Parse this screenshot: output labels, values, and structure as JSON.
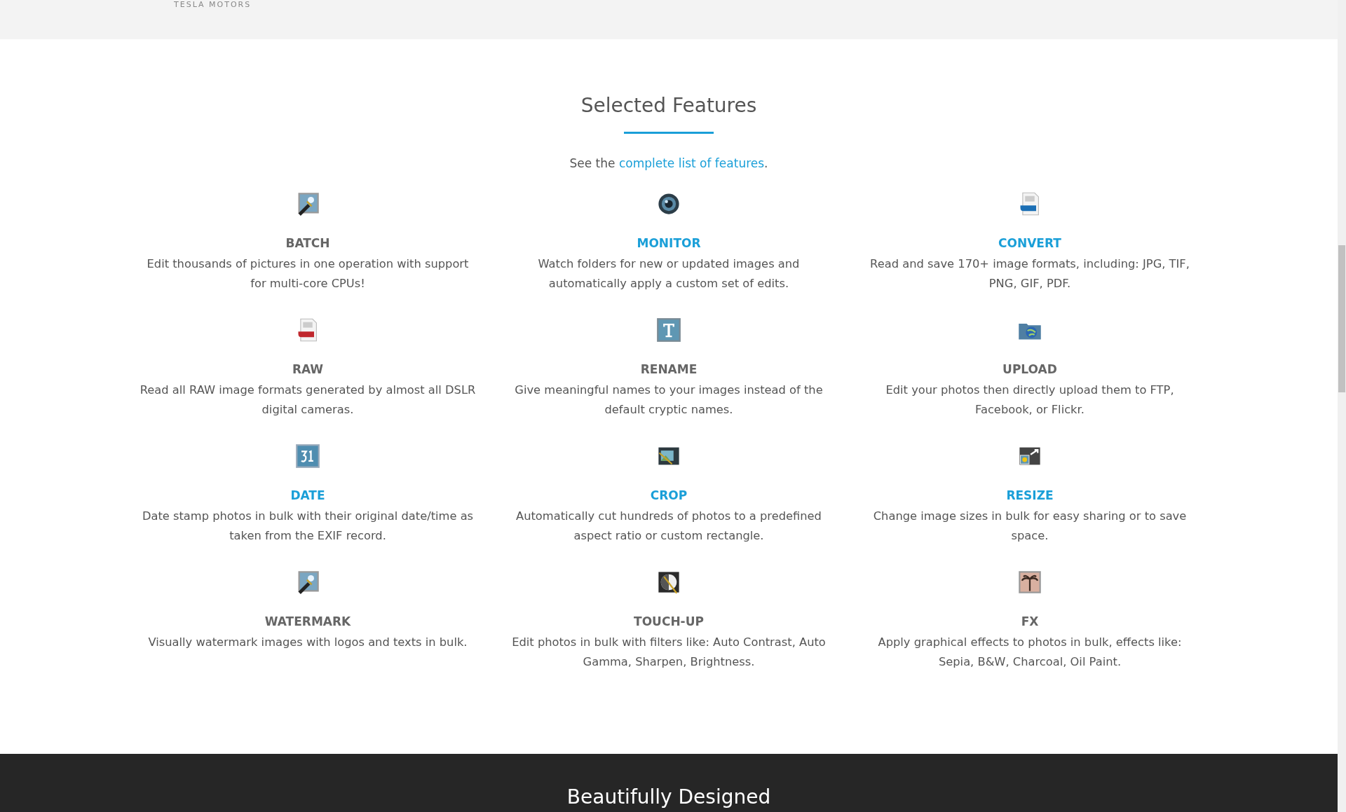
{
  "logo_strip": {
    "logo_text": "TESLA MOTORS"
  },
  "section": {
    "title": "Selected Features",
    "intro": {
      "before": "See the",
      "link": "complete list of features",
      "after": "."
    }
  },
  "features": [
    {
      "title": "BATCH",
      "highlighted": false,
      "description": "Edit thousands of pictures in one operation with support for multi-core CPUs!"
    },
    {
      "title": "MONITOR",
      "highlighted": true,
      "description": "Watch folders for new or updated images and automatically apply a custom set of edits."
    },
    {
      "title": "CONVERT",
      "highlighted": true,
      "description": "Read and save 170+ image formats, including: JPG, TIF, PNG, GIF, PDF."
    },
    {
      "title": "RAW",
      "highlighted": false,
      "description": "Read all RAW image formats generated by almost all DSLR digital cameras."
    },
    {
      "title": "RENAME",
      "highlighted": false,
      "description": "Give meaningful names to your images instead of the default cryptic names."
    },
    {
      "title": "UPLOAD",
      "highlighted": false,
      "description": "Edit your photos then directly upload them to FTP, Facebook, or Flickr."
    },
    {
      "title": "DATE",
      "highlighted": true,
      "description": "Date stamp photos in bulk with their original date/time as taken from the EXIF record."
    },
    {
      "title": "CROP",
      "highlighted": true,
      "description": "Automatically cut hundreds of photos to a predefined aspect ratio or custom rectangle."
    },
    {
      "title": "RESIZE",
      "highlighted": true,
      "description": "Change image sizes in bulk for easy sharing or to save space."
    },
    {
      "title": "WATERMARK",
      "highlighted": false,
      "description": "Visually watermark images with logos and texts in bulk."
    },
    {
      "title": "TOUCH-UP",
      "highlighted": false,
      "description": "Edit photos in bulk with filters like: Auto Contrast, Auto Gamma, Sharpen, Brightness."
    },
    {
      "title": "FX",
      "highlighted": false,
      "description": "Apply graphical effects to photos in bulk, effects like: Sepia, B&W, Charcoal, Oil Paint."
    }
  ],
  "footer_section": {
    "title": "Beautifully Designed"
  }
}
